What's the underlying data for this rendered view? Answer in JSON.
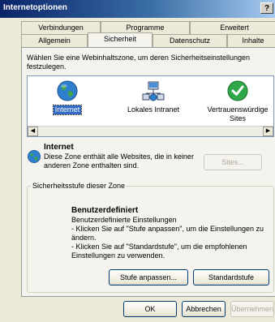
{
  "window": {
    "title": "Internetoptionen",
    "help_label": "?"
  },
  "tabs_back": [
    {
      "label": "Verbindungen"
    },
    {
      "label": "Programme"
    },
    {
      "label": "Erweitert"
    }
  ],
  "tabs_front": [
    {
      "label": "Allgemein"
    },
    {
      "label": "Sicherheit",
      "selected": true
    },
    {
      "label": "Datenschutz"
    },
    {
      "label": "Inhalte"
    }
  ],
  "security": {
    "intro_text": "Wählen Sie eine Webinhaltszone, um deren Sicherheitseinstellungen festzulegen.",
    "zones": [
      {
        "label": "Internet",
        "icon": "globe-icon",
        "selected": true
      },
      {
        "label": "Lokales Intranet",
        "icon": "intranet-icon"
      },
      {
        "label": "Vertrauenswürdige Sites",
        "icon": "checkmark-icon"
      }
    ],
    "selected_zone": {
      "title": "Internet",
      "description": "Diese Zone enthält alle Websites, die in keiner anderen Zone enthalten sind."
    },
    "sites_button": "Sites...",
    "group_label": "Sicherheitsstufe dieser Zone",
    "level": {
      "title": "Benutzerdefiniert",
      "lines": [
        "Benutzerdefinierte Einstellungen",
        "- Klicken Sie auf \"Stufe anpassen\", um die Einstellungen zu ändern.",
        "- Klicken Sie auf \"Standardstufe\", um die empfohlenen Einstellungen zu verwenden."
      ]
    },
    "custom_level_button": "Stufe anpassen...",
    "default_level_button": "Standardstufe"
  },
  "footer": {
    "ok": "OK",
    "cancel": "Abbrechen",
    "apply": "Übernehmen"
  },
  "colors": {
    "accent": "#316ac5",
    "titlebar": "#0a246a",
    "background": "#ece9d8"
  }
}
